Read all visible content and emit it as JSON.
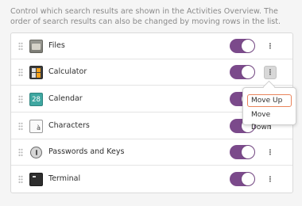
{
  "description": "Control which search results are shown in the Activities Overview. The order of search results can also be changed by moving rows in the list.",
  "accent_color": "#7b4a8b",
  "rows": [
    {
      "label": "Files",
      "icon": "folder-icon",
      "enabled": true
    },
    {
      "label": "Calculator",
      "icon": "calculator-icon",
      "enabled": true
    },
    {
      "label": "Calendar",
      "icon": "calendar-icon",
      "icon_text": "28",
      "enabled": true
    },
    {
      "label": "Characters",
      "icon": "characters-icon",
      "icon_text": "à",
      "enabled": true
    },
    {
      "label": "Passwords and Keys",
      "icon": "keyring-icon",
      "enabled": true
    },
    {
      "label": "Terminal",
      "icon": "terminal-icon",
      "enabled": true
    }
  ],
  "menu_button_glyph": "⋮",
  "popover": {
    "move_up": "Move Up",
    "move_down": "Move Down"
  }
}
